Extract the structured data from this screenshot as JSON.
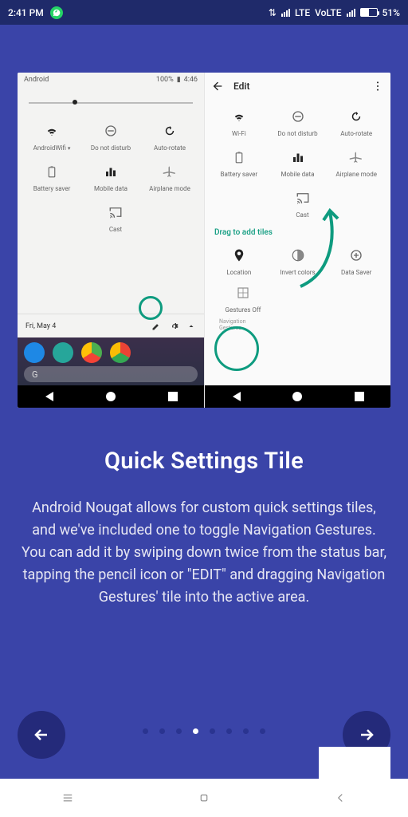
{
  "statusbar": {
    "time": "2:41 PM",
    "net1": "LTE",
    "net2": "VoLTE",
    "battery": "51%"
  },
  "left_pane": {
    "label": "Android",
    "status_right": "100%",
    "status_time": "4:46",
    "tiles1": [
      {
        "label": "AndroidWifi",
        "icon": "wifi",
        "dark": true,
        "dd": true
      },
      {
        "label": "Do not disturb",
        "icon": "dnd"
      },
      {
        "label": "Auto-rotate",
        "icon": "rotate",
        "dark": true
      }
    ],
    "tiles2": [
      {
        "label": "Battery saver",
        "icon": "battery"
      },
      {
        "label": "Mobile data",
        "icon": "mobile",
        "dark": true
      },
      {
        "label": "Airplane mode",
        "icon": "airplane"
      }
    ],
    "tiles3": [
      {
        "label": "Cast",
        "icon": "cast"
      }
    ],
    "date": "Fri, May 4",
    "search": "G"
  },
  "right_pane": {
    "title": "Edit",
    "tiles1": [
      {
        "label": "Wi-Fi",
        "icon": "wifi",
        "dark": true
      },
      {
        "label": "Do not disturb",
        "icon": "dnd"
      },
      {
        "label": "Auto-rotate",
        "icon": "rotate",
        "dark": true
      }
    ],
    "tiles2": [
      {
        "label": "Battery saver",
        "icon": "battery"
      },
      {
        "label": "Mobile data",
        "icon": "mobile",
        "dark": true
      },
      {
        "label": "Airplane mode",
        "icon": "airplane"
      }
    ],
    "tiles3": [
      {
        "label": "Cast",
        "icon": "cast"
      }
    ],
    "drag_label": "Drag to add tiles",
    "tiles4": [
      {
        "label": "Location",
        "icon": "location",
        "dark": true
      },
      {
        "label": "Invert colors",
        "icon": "invert"
      },
      {
        "label": "Data Saver",
        "icon": "datasaver"
      }
    ],
    "gesture_label": "Gestures Off",
    "gesture_sub": "Navigation Gestures"
  },
  "content": {
    "title": "Quick Settings Tile",
    "desc": "Android Nougat allows for custom quick settings tiles, and we've included one to toggle Navigation Gestures. You can add it by swiping down twice from the status bar, tapping the pencil icon or \"EDIT\" and dragging Navigation Gestures' tile into the active area."
  },
  "pager": {
    "count": 8,
    "active": 3
  }
}
